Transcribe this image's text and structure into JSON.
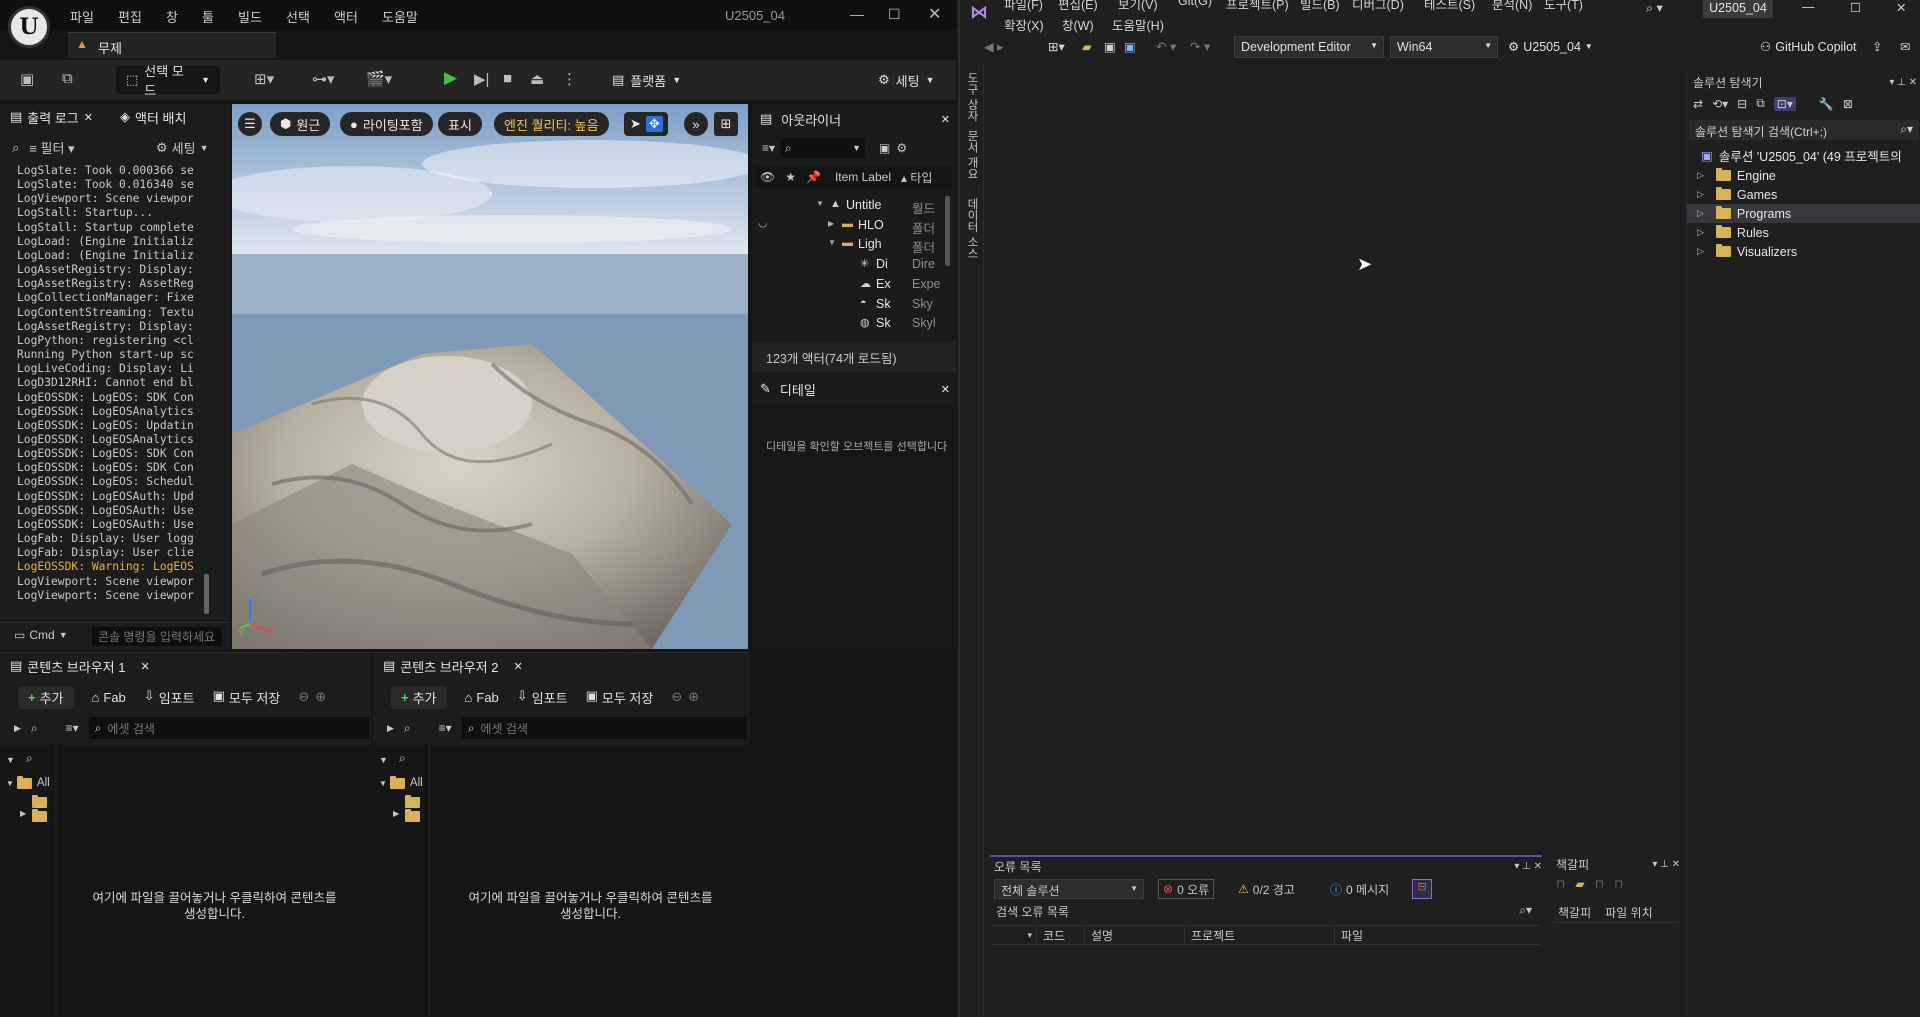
{
  "ue": {
    "menu": [
      "파일",
      "편집",
      "창",
      "툴",
      "빌드",
      "선택",
      "액터",
      "도움말"
    ],
    "project_title": "U2505_04",
    "level_tab": "무제",
    "toolbar": {
      "select_mode": "선택 모드",
      "platform": "플랫폼",
      "settings": "세팅"
    },
    "log_panel": {
      "tab_output": "출력 로그",
      "tab_place": "액터 배치",
      "filter": "필터",
      "settings": "세팅",
      "lines": [
        "LogSlate: Took 0.000366 se",
        "LogSlate: Took 0.016340 se",
        "LogViewport: Scene viewpor",
        "LogStall: Startup...",
        "LogStall: Startup complete",
        "LogLoad: (Engine Initializ",
        "LogLoad: (Engine Initializ",
        "LogAssetRegistry: Display:",
        "LogAssetRegistry: AssetReg",
        "LogCollectionManager: Fixe",
        "LogContentStreaming: Textu",
        "LogAssetRegistry: Display:",
        "LogPython: registering <cl",
        "Running Python start-up sc",
        "LogLiveCoding: Display: Li",
        "LogD3D12RHI: Cannot end bl",
        "LogEOSSDK: LogEOS: SDK Con",
        "LogEOSSDK: LogEOSAnalytics",
        "LogEOSSDK: LogEOS: Updatin",
        "LogEOSSDK: LogEOSAnalytics",
        "LogEOSSDK: LogEOS: SDK Con",
        "LogEOSSDK: LogEOS: SDK Con",
        "LogEOSSDK: LogEOS: Schedul",
        "LogEOSSDK: LogEOSAuth: Upd",
        "LogEOSSDK: LogEOSAuth: Use",
        "LogEOSSDK: LogEOSAuth: Use",
        "LogFab: Display: User logg",
        "LogFab: Display: User clie",
        "LogEOSSDK: Warning: LogEOS",
        "LogViewport: Scene viewpor",
        "LogViewport: Scene viewpor"
      ],
      "warning_index": 28,
      "cmd_label": "Cmd",
      "cmd_placeholder": "콘솔 명령을 입력하세요"
    },
    "viewport": {
      "perspective": "원근",
      "lighting": "라이팅포함",
      "show": "표시",
      "quality": "엔진 퀄리티: 높음",
      "axes": {
        "x": "X",
        "y": "Y",
        "z": "Z"
      }
    },
    "outliner": {
      "title": "아웃라이너",
      "col_label": "Item Label",
      "col_type": "타입",
      "rows": [
        {
          "label": "Untitle",
          "type": "월드"
        },
        {
          "label": "HLO",
          "type": "폴더"
        },
        {
          "label": "Ligh",
          "type": "폴더"
        },
        {
          "label": "Di",
          "type": "Dire"
        },
        {
          "label": "Ex",
          "type": "Expe"
        },
        {
          "label": "Sk",
          "type": "Sky"
        },
        {
          "label": "Sk",
          "type": "Skyl"
        }
      ],
      "count": "123개 액터(74개 로드됨)"
    },
    "details": {
      "title": "디테일",
      "empty": "디테일을 확인할 오브젝트를 선택합니다"
    },
    "content_browsers": [
      {
        "title": "콘텐츠 브라우저 1",
        "add": "추가",
        "fab": "Fab",
        "import": "임포트",
        "save_all": "모두 저장",
        "search": "에셋 검색",
        "all": "All",
        "empty_line1": "여기에 파일을 끌어놓거나 우클릭하여 콘텐츠를",
        "empty_line2": "생성합니다."
      },
      {
        "title": "콘텐츠 브라우저 2",
        "add": "추가",
        "fab": "Fab",
        "import": "임포트",
        "save_all": "모두 저장",
        "search": "에셋 검색",
        "all": "All",
        "empty_line1": "여기에 파일을 끌어놓거나 우클릭하여 콘텐츠를",
        "empty_line2": "생성합니다."
      }
    ]
  },
  "vs": {
    "menu_row1": [
      "파일(F)",
      "편집(E)",
      "보기(V)",
      "Git(G)",
      "프로젝트(P)",
      "빌드(B)",
      "디버그(D)",
      "테스트(S)",
      "분석(N)",
      "도구(T)"
    ],
    "menu_row2": [
      "확장(X)",
      "창(W)",
      "도움말(H)"
    ],
    "solution_name": "U2505_04",
    "config": "Development Editor",
    "platform": "Win64",
    "startup": "U2505_04",
    "copilot": "GitHub Copilot",
    "left_strip": [
      "도구 상자",
      "문서 개요",
      "데이터 소스"
    ],
    "explorer": {
      "title": "솔루션 탐색기",
      "search": "솔루션 탐색기 검색(Ctrl+;)",
      "root": "솔루션 'U2505_04' (49 프로젝트의",
      "folders": [
        "Engine",
        "Games",
        "Programs",
        "Rules",
        "Visualizers"
      ],
      "selected_index": 2
    },
    "error_list": {
      "title": "오류 목록",
      "scope": "전체 솔루션",
      "errors": "0 오류",
      "warnings": "0/2 경고",
      "messages": "0 메시지",
      "search": "검색 오류 목록",
      "columns": [
        "코드",
        "설명",
        "프로젝트",
        "파일"
      ]
    },
    "bookmarks": {
      "title": "책갈피",
      "col1": "책갈피",
      "col2": "파일 위치"
    }
  }
}
